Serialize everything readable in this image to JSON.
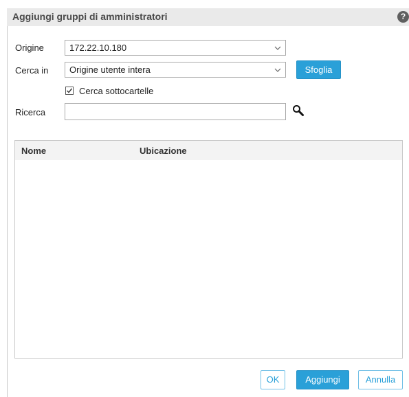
{
  "dialog": {
    "title": "Aggiungi gruppi di amministratori",
    "help_glyph": "?"
  },
  "form": {
    "origine_label": "Origine",
    "origine_value": "172.22.10.180",
    "cerca_in_label": "Cerca in",
    "cerca_in_value": "Origine utente intera",
    "sfoglia_label": "Sfoglia",
    "subfolders_label": "Cerca sottocartelle",
    "subfolders_checked": true,
    "ricerca_label": "Ricerca",
    "ricerca_value": ""
  },
  "table": {
    "columns": [
      "Nome",
      "Ubicazione"
    ],
    "rows": []
  },
  "footer": {
    "ok_label": "OK",
    "add_label": "Aggiungi",
    "cancel_label": "Annulla"
  },
  "colors": {
    "accent": "#2aa0d8",
    "titlebar": "#eaeaea"
  }
}
